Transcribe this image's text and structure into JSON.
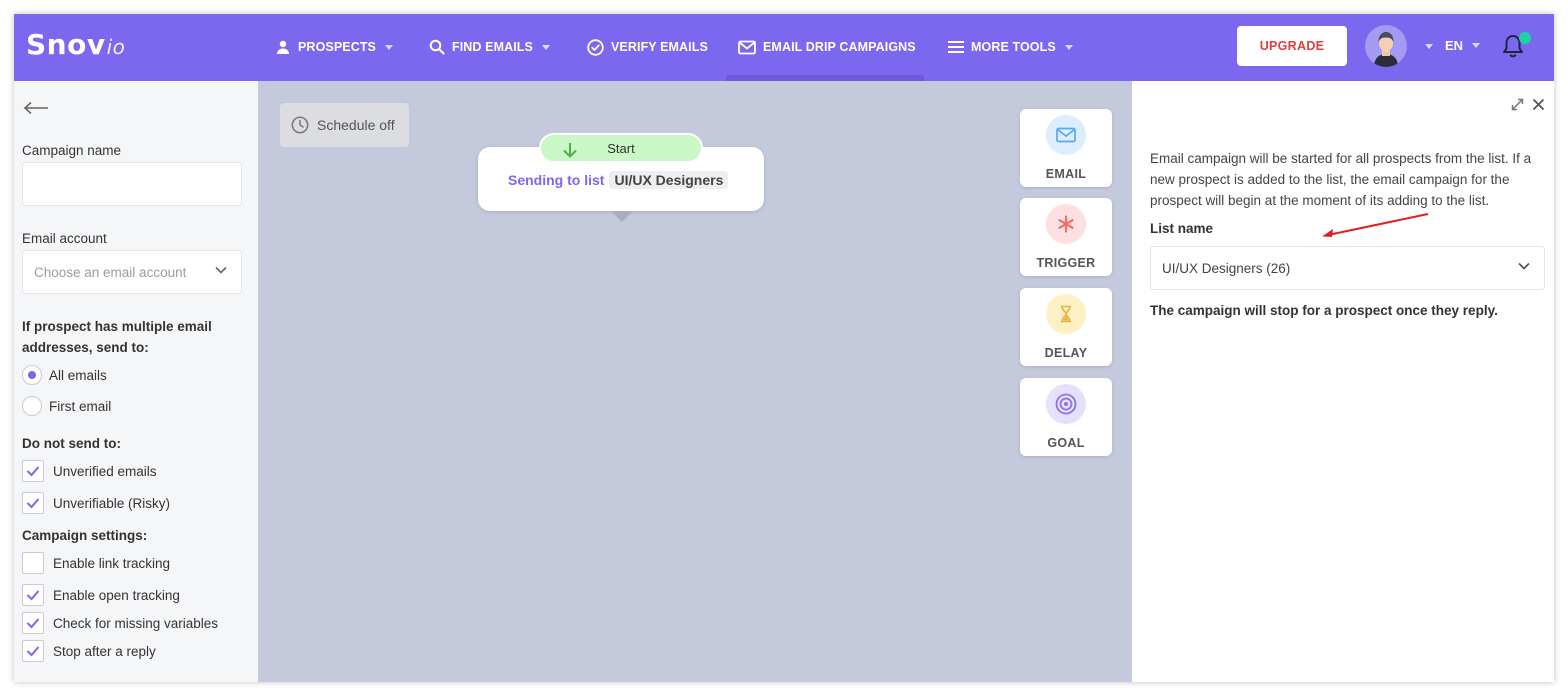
{
  "header": {
    "logo_main": "Snov",
    "logo_suffix": "io",
    "nav": [
      {
        "label": "PROSPECTS",
        "icon": "person-icon",
        "has_caret": true
      },
      {
        "label": "FIND EMAILS",
        "icon": "search-icon",
        "has_caret": true
      },
      {
        "label": "VERIFY EMAILS",
        "icon": "check-circle-icon",
        "has_caret": false
      },
      {
        "label": "EMAIL DRIP CAMPAIGNS",
        "icon": "envelope-icon",
        "has_caret": false,
        "active": true
      },
      {
        "label": "MORE TOOLS",
        "icon": "menu-icon",
        "has_caret": true
      }
    ],
    "upgrade_label": "UPGRADE",
    "language": "EN",
    "colors": {
      "brand": "#7b68ee",
      "upgrade_text": "#e0403a",
      "notification_dot": "#1ed3a3"
    }
  },
  "sidebar": {
    "campaign_name_label": "Campaign name",
    "campaign_name_value": "",
    "email_account_label": "Email account",
    "email_account_placeholder": "Choose an email account",
    "multiple_label": "If prospect has multiple email addresses, send to:",
    "send_options": [
      {
        "label": "All emails",
        "selected": true
      },
      {
        "label": "First email",
        "selected": false
      }
    ],
    "do_not_send_label": "Do not send to:",
    "do_not_send": [
      {
        "label": "Unverified emails",
        "checked": true
      },
      {
        "label": "Unverifiable (Risky)",
        "checked": true
      }
    ],
    "settings_label": "Campaign settings:",
    "settings": [
      {
        "label": "Enable link tracking",
        "checked": false
      },
      {
        "label": "Enable open tracking",
        "checked": true
      },
      {
        "label": "Check for missing variables",
        "checked": true
      },
      {
        "label": "Stop after a reply",
        "checked": true
      }
    ]
  },
  "canvas": {
    "schedule_label": "Schedule off",
    "start_label": "Start",
    "sending_prefix": "Sending to list",
    "list_tag": "UI/UX Designers",
    "tools": [
      {
        "label": "EMAIL",
        "icon": "envelope-icon",
        "color": "#5aa9ec",
        "bg": "#dceefd"
      },
      {
        "label": "TRIGGER",
        "icon": "asterisk-icon",
        "color": "#f06a6a",
        "bg": "#fde0e0"
      },
      {
        "label": "DELAY",
        "icon": "hourglass-icon",
        "color": "#e6b33b",
        "bg": "#fdf0c4"
      },
      {
        "label": "GOAL",
        "icon": "target-icon",
        "color": "#8b73e8",
        "bg": "#e6e0fb"
      }
    ]
  },
  "panel": {
    "description": "Email campaign will be started for all prospects from the list. If a new prospect is added to the list, the email campaign for the prospect will begin at the moment of its adding to the list.",
    "list_name_label": "List name",
    "list_selected": "UI/UX Designers (26)",
    "stop_note": "The campaign will stop for a prospect once they reply."
  }
}
